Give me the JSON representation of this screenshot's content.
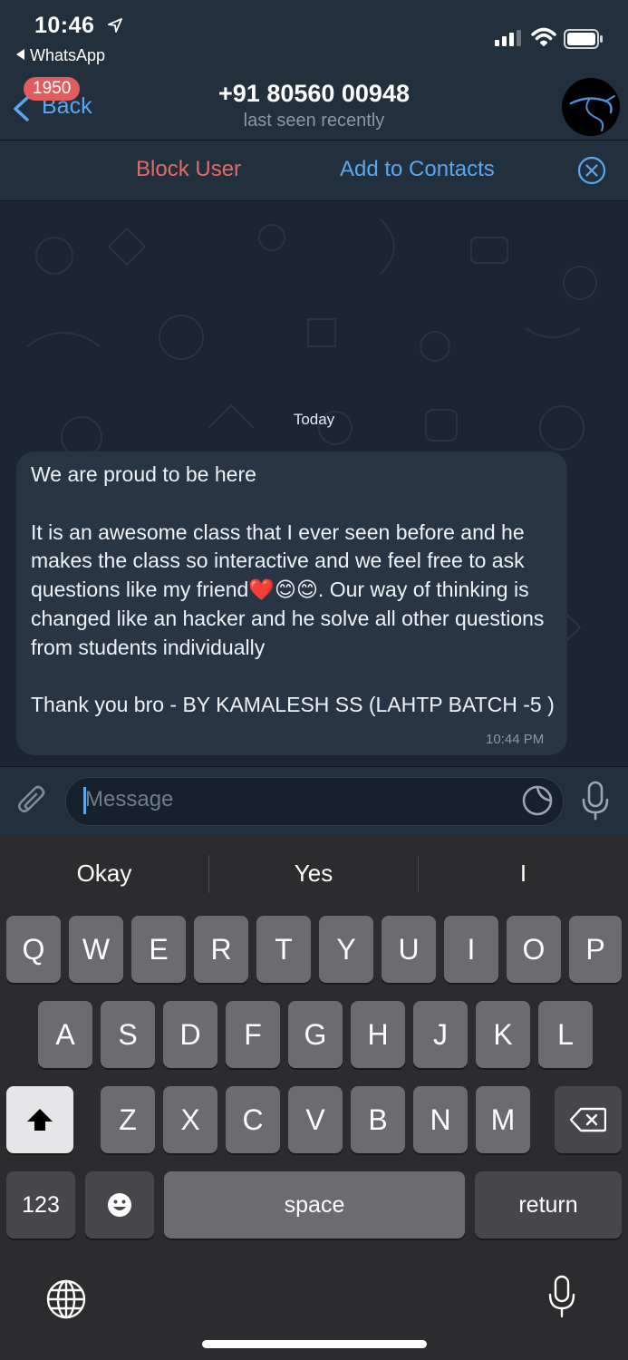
{
  "status_bar": {
    "time": "10:46",
    "back_app": "WhatsApp"
  },
  "header": {
    "back_label": "Back",
    "unread_badge": "1950",
    "title": "+91 80560 00948",
    "subtitle": "last seen recently"
  },
  "action_bar": {
    "block_label": "Block User",
    "add_label": "Add to Contacts"
  },
  "chat": {
    "date_separator": "Today",
    "message": {
      "text": "We are proud to be here\n\nIt is an awesome class that I ever seen before and he makes the class so interactive and we feel free to ask questions like my friend❤️😊😊. Our way of thinking is changed like an hacker and he solve all other questions from students individually\n\nThank you bro - BY KAMALESH SS (LAHTP BATCH -5 )",
      "time": "10:44 PM"
    }
  },
  "composer": {
    "placeholder": "Message"
  },
  "keyboard": {
    "suggestions": [
      "Okay",
      "Yes",
      "I"
    ],
    "row1": [
      "Q",
      "W",
      "E",
      "R",
      "T",
      "Y",
      "U",
      "I",
      "O",
      "P"
    ],
    "row2": [
      "A",
      "S",
      "D",
      "F",
      "G",
      "H",
      "J",
      "K",
      "L"
    ],
    "row3": [
      "Z",
      "X",
      "C",
      "V",
      "B",
      "N",
      "M"
    ],
    "numbers_label": "123",
    "space_label": "space",
    "return_label": "return"
  },
  "colors": {
    "accent": "#5aa6ef",
    "danger": "#e26a66",
    "bubble": "#283545"
  }
}
